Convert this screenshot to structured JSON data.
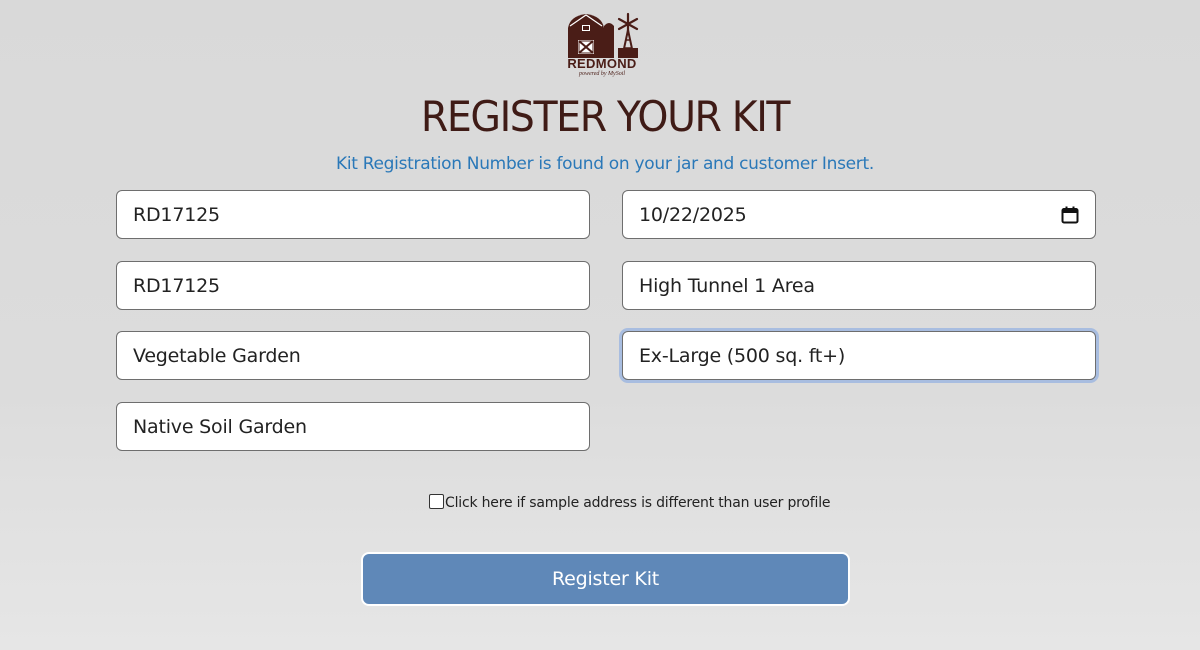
{
  "logo": {
    "brand": "REDMOND",
    "tagline": "powered by MySoil"
  },
  "header": {
    "title": "REGISTER YOUR KIT",
    "subtitle": "Kit Registration Number is found on your jar and customer Insert."
  },
  "form": {
    "kit_number": "RD17125",
    "date": "10/22/2025",
    "kit_number_confirm": "RD17125",
    "sample_name": "High Tunnel 1 Area",
    "garden_type": "Vegetable Garden",
    "area_size": "Ex-Large (500 sq. ft+)",
    "soil_type": "Native Soil Garden",
    "focused_field": "area_size",
    "date_picker_icon": "calendar-icon"
  },
  "address_checkbox": {
    "label": "Click here if sample address is different than user profile",
    "checked": false
  },
  "submit": {
    "label": "Register Kit",
    "color": "#5f88b8"
  },
  "colors": {
    "brand": "#4a1d17",
    "title": "#3f1b16",
    "subtitle": "#2a78b8",
    "focus_ring": "#a8bde0"
  }
}
